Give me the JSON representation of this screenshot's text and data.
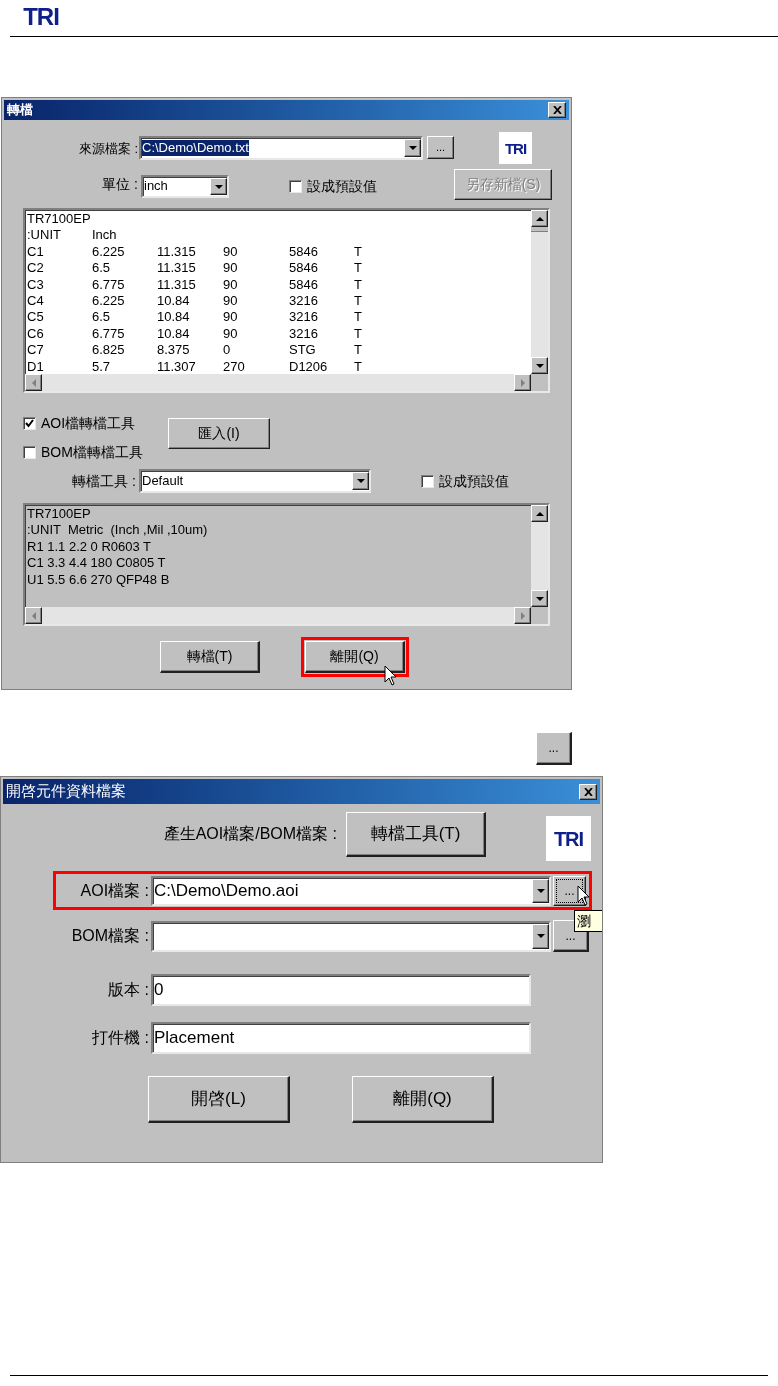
{
  "page_header": {
    "logo": "TRI"
  },
  "convert_dialog": {
    "title": "轉檔",
    "source": {
      "label": "來源檔案 :",
      "value": "C:\\Demo\\Demo.txt",
      "text_selected": true,
      "browse": "..."
    },
    "logo": "TRI",
    "unit": {
      "label": "單位 :",
      "value": "inch"
    },
    "unit_default": {
      "label": "設成預設值",
      "checked": false
    },
    "save_as": {
      "label": "另存新檔(S)",
      "disabled": true
    },
    "listing": [
      [
        "TR7100EP"
      ],
      [
        ":UNIT",
        "Inch"
      ],
      [
        "C1",
        "6.225",
        "11.315",
        "90",
        "5846",
        "T"
      ],
      [
        "C2",
        "6.5",
        "11.315",
        "90",
        "5846",
        "T"
      ],
      [
        "C3",
        "6.775",
        "11.315",
        "90",
        "5846",
        "T"
      ],
      [
        "C4",
        "6.225",
        "10.84",
        "90",
        "3216",
        "T"
      ],
      [
        "C5",
        "6.5",
        "10.84",
        "90",
        "3216",
        "T"
      ],
      [
        "C6",
        "6.775",
        "10.84",
        "90",
        "3216",
        "T"
      ],
      [
        "C7",
        "6.825",
        "8.375",
        "0",
        "STG",
        "T"
      ],
      [
        "D1",
        "5.7",
        "11.307",
        "270",
        "D1206",
        "T"
      ]
    ],
    "tools": [
      {
        "label": "AOI檔轉檔工具",
        "checked": true
      },
      {
        "label": "BOM檔轉檔工具",
        "checked": false
      }
    ],
    "import_button": "匯入(I)",
    "converter": {
      "label": "轉檔工具 :",
      "value": "Default"
    },
    "converter_default": {
      "label": "設成預設值",
      "checked": false
    },
    "example": [
      "TR7100EP",
      ":UNIT  Metric  (Inch ,Mil ,10um)",
      "R1 1.1 2.2 0 R0603 T",
      "C1 3.3 4.4 180 C0805 T",
      "U1 5.5 6.6 270 QFP48 B"
    ],
    "buttons": [
      {
        "label": "轉檔(T)",
        "highlighted": false
      },
      {
        "label": "離開(Q)",
        "highlighted": true
      }
    ]
  },
  "browse_button_sample": "...",
  "open_dialog": {
    "title": "開啓元件資料檔案",
    "generate": {
      "label": "產生AOI檔案/BOM檔案 :",
      "button": "轉檔工具(T)"
    },
    "logo": "TRI",
    "aoi": {
      "label": "AOI檔案 :",
      "value": "C:\\Demo\\Demo.aoi",
      "browse": "...",
      "highlighted": true,
      "tooltip": "瀏"
    },
    "bom": {
      "label": "BOM檔案 :",
      "browse": "..."
    },
    "version": {
      "label": "版本 :",
      "value": "0"
    },
    "machine": {
      "label": "打件機 :",
      "value": "Placement"
    },
    "buttons": [
      "開啓(L)",
      "離開(Q)"
    ]
  }
}
